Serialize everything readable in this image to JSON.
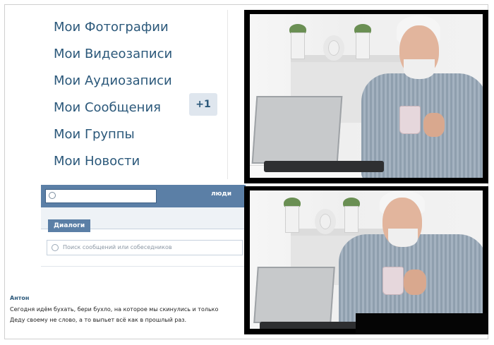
{
  "menu": {
    "items": [
      "Мои Фотографии",
      "Мои Видеозаписи",
      "Мои Аудиозаписи",
      "Мои Сообщения",
      "Мои Группы",
      "Мои Новости"
    ],
    "badge": "+1"
  },
  "vk": {
    "people_label": "люди",
    "tab_dialogs": "Диалоги",
    "search_placeholder": "Поиск сообщений или собеседников"
  },
  "comment": {
    "author": "Антон",
    "line1": "Сегодня идём бухать, бери бухло, на которое мы скинулись и только",
    "line2": "Деду своему не слово, а то выпьет всё как в прошлый раз."
  },
  "colors": {
    "vk_blue": "#5b7fa6",
    "link_blue": "#2b587a"
  }
}
